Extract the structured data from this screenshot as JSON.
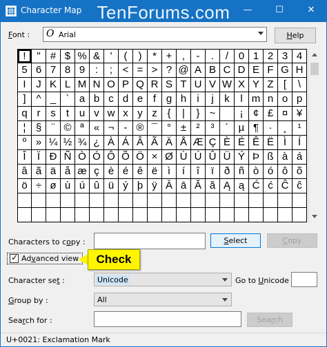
{
  "window": {
    "title": "Character Map",
    "watermark": "TenForums.com",
    "minimize_glyph": "—",
    "maximize_glyph": "☐",
    "close_glyph": "✕"
  },
  "font": {
    "label_pre": "",
    "label_u": "F",
    "label_post": "ont :",
    "value": "Arial",
    "icon_glyph": "O"
  },
  "help_button": {
    "label_pre": "",
    "label_u": "H",
    "label_post": "elp"
  },
  "grid": {
    "columns": 20,
    "selected_index": 0,
    "rows": [
      [
        "!",
        "\"",
        "#",
        "$",
        "%",
        "&",
        "'",
        "(",
        ")",
        "*",
        "+",
        ",",
        "-",
        ".",
        "/",
        "0",
        "1",
        "2",
        "3",
        "4"
      ],
      [
        "5",
        "6",
        "7",
        "8",
        "9",
        ":",
        ";",
        "<",
        "=",
        ">",
        "?",
        "@",
        "A",
        "B",
        "C",
        "D",
        "E",
        "F",
        "G",
        "H"
      ],
      [
        "I",
        "J",
        "K",
        "L",
        "M",
        "N",
        "O",
        "P",
        "Q",
        "R",
        "S",
        "T",
        "U",
        "V",
        "W",
        "X",
        "Y",
        "Z",
        "[",
        "\\"
      ],
      [
        "]",
        "^",
        "_",
        "`",
        "a",
        "b",
        "c",
        "d",
        "e",
        "f",
        "g",
        "h",
        "i",
        "j",
        "k",
        "l",
        "m",
        "n",
        "o",
        "p"
      ],
      [
        "q",
        "r",
        "s",
        "t",
        "u",
        "v",
        "w",
        "x",
        "y",
        "z",
        "{",
        "|",
        "}",
        "~",
        "",
        "¡",
        "¢",
        "£",
        "¤",
        "¥"
      ],
      [
        "¦",
        "§",
        "¨",
        "©",
        "ª",
        "«",
        "¬",
        "-",
        "®",
        "¯",
        "°",
        "±",
        "²",
        "³",
        "´",
        "µ",
        "¶",
        "·",
        "¸",
        "¹"
      ],
      [
        "º",
        "»",
        "¼",
        "½",
        "¾",
        "¿",
        "À",
        "Á",
        "Â",
        "Ã",
        "Ä",
        "Å",
        "Æ",
        "Ç",
        "È",
        "É",
        "Ê",
        "Ë",
        "Ì",
        "Í"
      ],
      [
        "Î",
        "Ï",
        "Ð",
        "Ñ",
        "Ò",
        "Ó",
        "Ô",
        "Õ",
        "Ö",
        "×",
        "Ø",
        "Ù",
        "Ú",
        "Û",
        "Ü",
        "Ý",
        "Þ",
        "ß",
        "à",
        "á"
      ],
      [
        "â",
        "ã",
        "ä",
        "å",
        "æ",
        "ç",
        "è",
        "é",
        "ê",
        "ë",
        "ì",
        "í",
        "î",
        "ï",
        "ð",
        "ñ",
        "ò",
        "ó",
        "ô",
        "õ"
      ],
      [
        "ö",
        "÷",
        "ø",
        "ù",
        "ú",
        "û",
        "ü",
        "ý",
        "þ",
        "ÿ",
        "Ā",
        "ā",
        "Ă",
        "ă",
        "Ą",
        "ą",
        "Ć",
        "ć",
        "Ĉ",
        "ĉ"
      ]
    ]
  },
  "copy": {
    "label_pre": "Characters to c",
    "label_u": "o",
    "label_post": "py :",
    "value": ""
  },
  "select_button": {
    "label_pre": "",
    "label_u": "S",
    "label_post": "elect"
  },
  "copy_button": {
    "label_pre": "",
    "label_u": "C",
    "label_post": "opy"
  },
  "advanced": {
    "label_pre": "Ad",
    "label_u": "v",
    "label_post": "anced view",
    "checked": true,
    "check_glyph": "✓"
  },
  "callout": {
    "text": "Check",
    "color": "#fff500"
  },
  "charset": {
    "label_pre": "Character se",
    "label_u": "t",
    "label_post": " :",
    "value": "Unicode"
  },
  "goto_unicode": {
    "label_pre": "Go to ",
    "label_u": "U",
    "label_post": "nicode :",
    "value": ""
  },
  "groupby": {
    "label_pre": "",
    "label_u": "G",
    "label_post": "roup by :",
    "value": "All"
  },
  "search": {
    "label_pre": "Sea",
    "label_u": "r",
    "label_post": "ch for :",
    "value": "",
    "button_pre": "Sea",
    "button_u": "r",
    "button_post": "ch"
  },
  "status": {
    "text": "U+0021: Exclamation Mark"
  },
  "colors": {
    "titlebar": "#1672c4",
    "client": "#f0f0f0",
    "accent": "#0078d7"
  }
}
